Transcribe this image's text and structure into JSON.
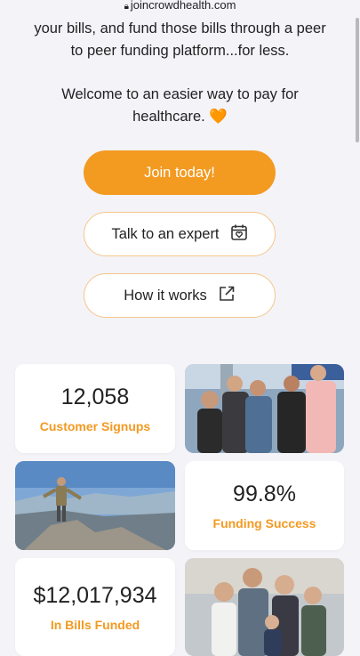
{
  "browser": {
    "url": "joincrowdhealth.com"
  },
  "intro": {
    "line1": "your bills, and fund those bills through a peer",
    "line2": "to peer funding platform...for less.",
    "welcome1": "Welcome to an easier way to pay for",
    "welcome2": "healthcare. ",
    "heart": "🧡"
  },
  "buttons": {
    "join": "Join today!",
    "expert": "Talk to an expert",
    "how": "How it works"
  },
  "stats": {
    "signups": {
      "value": "12,058",
      "label": "Customer Signups"
    },
    "funding": {
      "value": "99.8%",
      "label": "Funding Success"
    },
    "bills": {
      "value": "$12,017,934",
      "label": "In Bills Funded"
    }
  },
  "icons": {
    "expert": "calendar-heart-icon",
    "how": "external-link-icon",
    "lock": "lock-icon"
  },
  "colors": {
    "accent": "#f39a21",
    "background": "#f4f3f8"
  }
}
